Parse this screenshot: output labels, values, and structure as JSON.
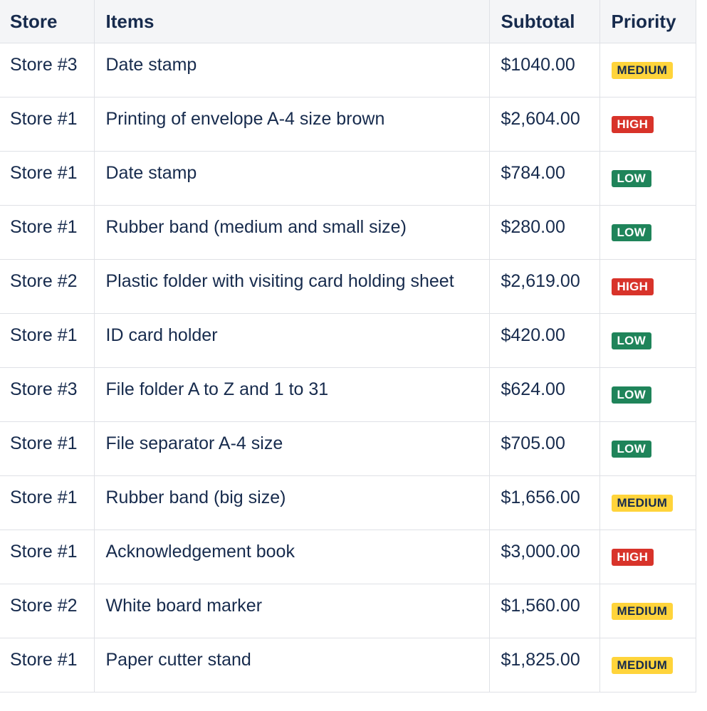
{
  "table": {
    "headers": {
      "store": "Store",
      "items": "Items",
      "subtotal": "Subtotal",
      "priority": "Priority"
    },
    "priority_colors": {
      "MEDIUM": "#ffd43b",
      "HIGH": "#d8332a",
      "LOW": "#1f845a"
    },
    "rows": [
      {
        "store": "Store #3",
        "item": "Date stamp",
        "subtotal": "$1040.00",
        "priority": "MEDIUM"
      },
      {
        "store": "Store #1",
        "item": "Printing of envelope A-4 size brown",
        "subtotal": "$2,604.00",
        "priority": "HIGH"
      },
      {
        "store": "Store #1",
        "item": "Date stamp",
        "subtotal": "$784.00",
        "priority": "LOW"
      },
      {
        "store": "Store #1",
        "item": "Rubber band (medium and small size)",
        "subtotal": "$280.00",
        "priority": "LOW"
      },
      {
        "store": "Store #2",
        "item": "Plastic folder with visiting card holding sheet",
        "subtotal": "$2,619.00",
        "priority": "HIGH"
      },
      {
        "store": "Store #1",
        "item": "ID card holder",
        "subtotal": "$420.00",
        "priority": "LOW"
      },
      {
        "store": "Store #3",
        "item": "File folder A to Z and 1 to 31",
        "subtotal": "$624.00",
        "priority": "LOW"
      },
      {
        "store": "Store #1",
        "item": "File separator A-4 size",
        "subtotal": "$705.00",
        "priority": "LOW"
      },
      {
        "store": "Store #1",
        "item": "Rubber band (big size)",
        "subtotal": "$1,656.00",
        "priority": "MEDIUM"
      },
      {
        "store": "Store #1",
        "item": "Acknowledgement book",
        "subtotal": "$3,000.00",
        "priority": "HIGH"
      },
      {
        "store": "Store #2",
        "item": "White board marker",
        "subtotal": "$1,560.00",
        "priority": "MEDIUM"
      },
      {
        "store": "Store #1",
        "item": "Paper cutter stand",
        "subtotal": "$1,825.00",
        "priority": "MEDIUM"
      }
    ]
  }
}
